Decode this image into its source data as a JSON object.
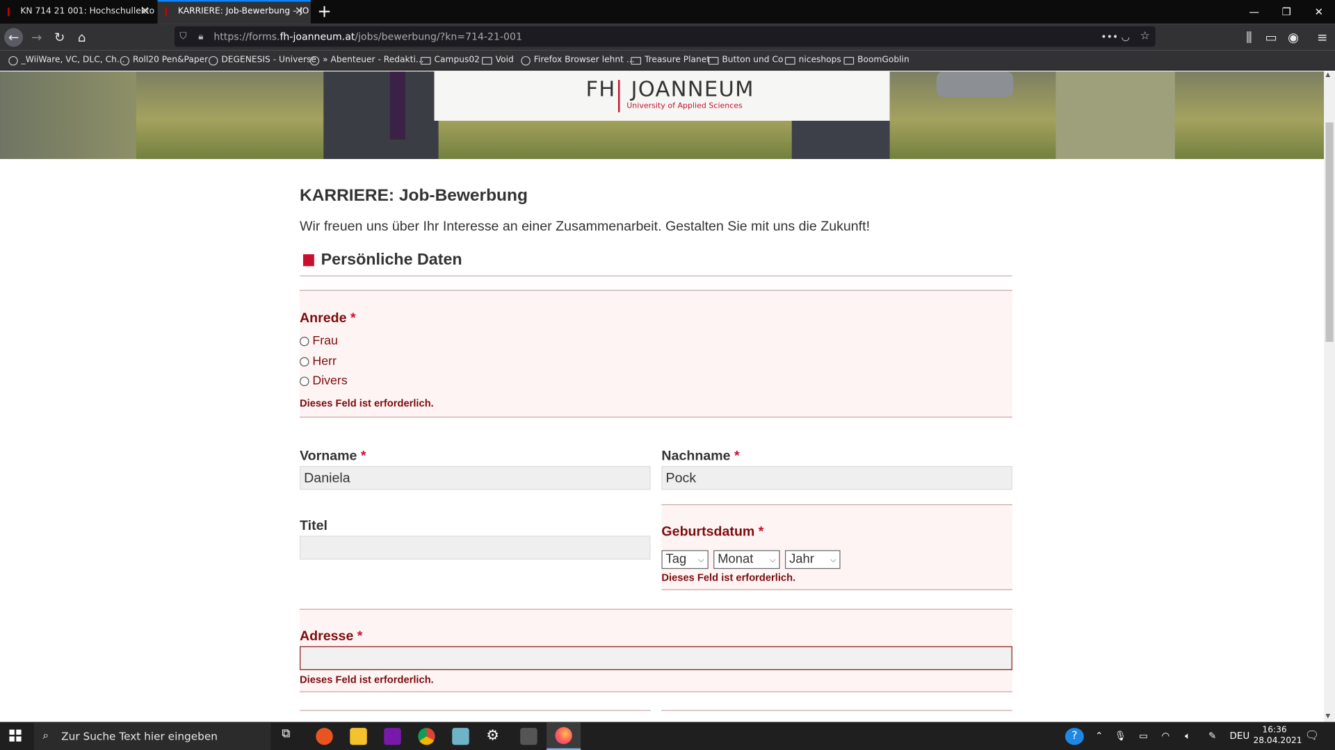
{
  "browser": {
    "tabs": [
      {
        "title": "KN 714 21 001: Hochschullekto",
        "active": false
      },
      {
        "title": "KARRIERE: Job-Bewerbung – JO",
        "active": true
      }
    ],
    "url_prefix": "https://forms.",
    "url_domain": "fh-joanneum.at",
    "url_path": "/jobs/bewerbung/?kn=714-21-001",
    "bookmarks": [
      {
        "label": "_WiiWare, VC, DLC, Ch...",
        "icon": "globe-icon"
      },
      {
        "label": "Roll20 Pen&Paper",
        "icon": "globe-icon"
      },
      {
        "label": "DEGENESIS - Universe",
        "icon": "globe-icon"
      },
      {
        "label": "» Abenteuer - Redakti...",
        "icon": "globe-icon"
      },
      {
        "label": "Campus02",
        "icon": "folder-icon"
      },
      {
        "label": "Void",
        "icon": "folder-icon"
      },
      {
        "label": "Firefox Browser lehnt ...",
        "icon": "globe-icon"
      },
      {
        "label": "Treasure Planet",
        "icon": "folder-icon"
      },
      {
        "label": "Button und Co",
        "icon": "folder-icon"
      },
      {
        "label": "niceshops",
        "icon": "folder-icon"
      },
      {
        "label": "BoomGoblin",
        "icon": "folder-icon"
      }
    ]
  },
  "header": {
    "logo_left": "FH",
    "logo_right": "JOANNEUM",
    "logo_sub": "University of Applied Sciences"
  },
  "page": {
    "title": "KARRIERE: Job-Bewerbung",
    "intro": "Wir freuen uns über Ihr Interesse an einer Zusammenarbeit. Gestalten Sie mit uns die Zukunft!",
    "section_title": "Persönliche Daten"
  },
  "form": {
    "required_mark": "*",
    "error_text": "Dieses Feld ist erforderlich.",
    "anrede": {
      "label": "Anrede",
      "options": [
        "Frau",
        "Herr",
        "Divers"
      ]
    },
    "vorname": {
      "label": "Vorname",
      "value": "Daniela"
    },
    "nachname": {
      "label": "Nachname",
      "value": "Pock"
    },
    "titel": {
      "label": "Titel",
      "value": ""
    },
    "geburtsdatum": {
      "label": "Geburtsdatum",
      "day": "Tag",
      "month": "Monat",
      "year": "Jahr"
    },
    "adresse": {
      "label": "Adresse",
      "value": ""
    }
  },
  "taskbar": {
    "search_placeholder": "Zur Suche Text hier eingeben",
    "lang": "DEU",
    "time": "16:36",
    "date": "28.04.2021"
  },
  "colors": {
    "accent": "#c8102e",
    "error_text": "#7a0c0c",
    "error_bg": "#fff4f4",
    "tab_active": "#323234"
  }
}
